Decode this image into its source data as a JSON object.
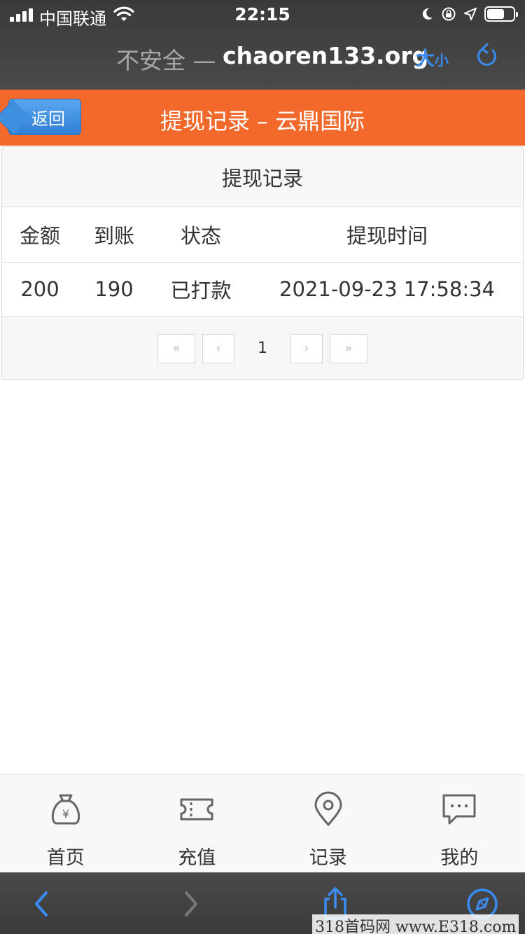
{
  "status_bar": {
    "carrier": "中国联通",
    "time": "22:15"
  },
  "url_bar": {
    "insecure_label": "不安全 —",
    "host": "chaoren133.org",
    "size_big": "大",
    "size_small": "小"
  },
  "header": {
    "back_label": "返回",
    "title": "提现记录 – 云鼎国际"
  },
  "panel": {
    "heading": "提现记录",
    "columns": [
      "金额",
      "到账",
      "状态",
      "提现时间"
    ],
    "rows": [
      [
        "200",
        "190",
        "已打款",
        "2021-09-23 17:58:34"
      ]
    ],
    "pagination": {
      "first": "«",
      "prev": "‹",
      "current": "1",
      "next": "›",
      "last": "»"
    }
  },
  "tabbar": {
    "items": [
      {
        "label": "首页",
        "icon": "money-bag-icon"
      },
      {
        "label": "充值",
        "icon": "ticket-icon"
      },
      {
        "label": "记录",
        "icon": "location-pin-icon"
      },
      {
        "label": "我的",
        "icon": "chat-bubble-icon"
      }
    ]
  },
  "watermark": "318首码网 www.E318.com",
  "colors": {
    "header_orange": "#f2692b",
    "ios_blue": "#3b8cf2",
    "back_button": "#3f8fe0"
  }
}
